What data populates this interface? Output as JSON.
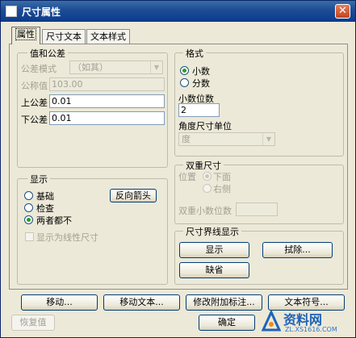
{
  "window": {
    "title": "尺寸属性",
    "close_glyph": "✕"
  },
  "tabs": [
    {
      "label": "属性",
      "active": true
    },
    {
      "label": "尺寸文本",
      "active": false
    },
    {
      "label": "文本样式",
      "active": false
    }
  ],
  "value_tolerance": {
    "title": "值和公差",
    "tolerance_mode_label": "公差模式",
    "tolerance_mode_value": "（如其）",
    "nominal_label": "公称值",
    "nominal_value": "103.00",
    "upper_label": "上公差",
    "upper_value": "0.01",
    "lower_label": "下公差",
    "lower_value": "0.01"
  },
  "format": {
    "title": "格式",
    "decimal_label": "小数",
    "fraction_label": "分数",
    "selected": "decimal",
    "decimal_places_label": "小数位数",
    "decimal_places_value": "2",
    "angle_unit_label": "角度尺寸单位",
    "angle_unit_value": "度"
  },
  "display": {
    "title": "显示",
    "basic_label": "基础",
    "inspection_label": "检查",
    "neither_label": "两者都不",
    "selected": "neither",
    "flip_arrows_label": "反向箭头",
    "show_linear_label": "显示为线性尺寸"
  },
  "dual_dimension": {
    "title": "双重尺寸",
    "position_label": "位置",
    "below_label": "下面",
    "right_label": "右侧",
    "decimal_places_label": "双重小数位数"
  },
  "witness_line": {
    "title": "尺寸界线显示",
    "show_label": "显示",
    "erase_label": "拭除...",
    "default_label": "缺省"
  },
  "bottom_buttons": {
    "move": "移动...",
    "move_text": "移动文本...",
    "modify_attach": "修改附加标注...",
    "text_symbol": "文本符号...",
    "restore": "恢复值",
    "ok": "确定"
  },
  "watermark": {
    "text": "资料网",
    "url": "ZL.XS1616.COM"
  },
  "colors": {
    "title_bar": "#1f4e96",
    "dialog_bg": "#ece9d8",
    "radio_dot": "#21a121"
  }
}
